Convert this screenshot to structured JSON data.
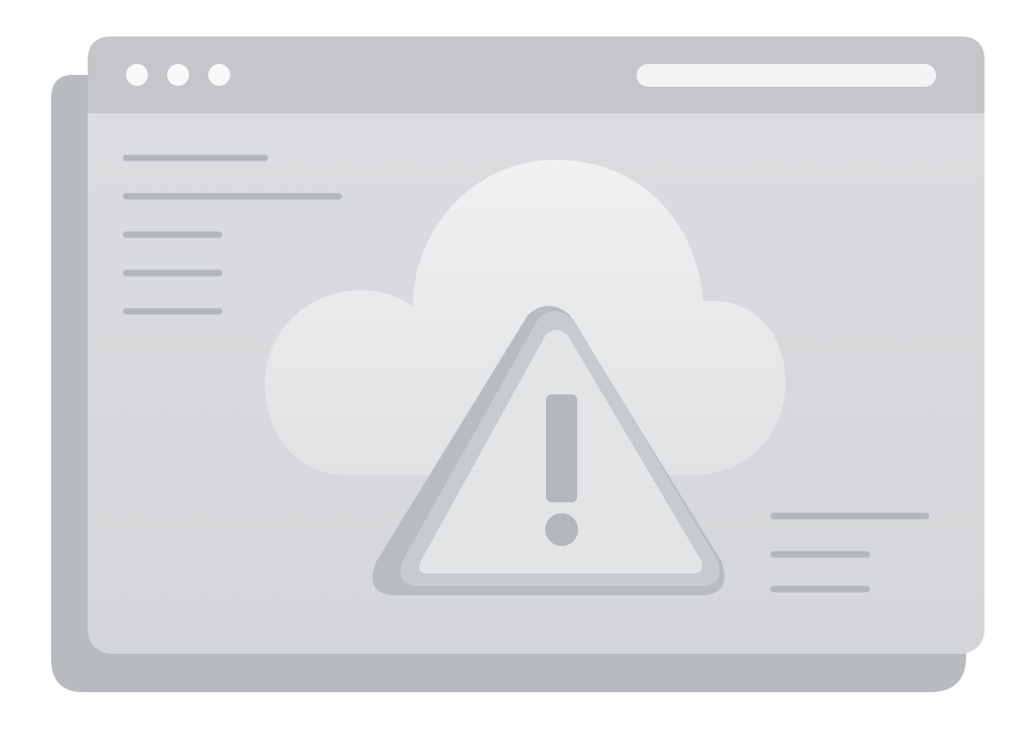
{
  "illustration": {
    "kind": "browser-window-cloud-error",
    "icons": [
      "window-dots-icon",
      "address-bar-icon",
      "cloud-icon",
      "warning-triangle-icon"
    ],
    "colors": {
      "window_back": "#b9bcc0",
      "window_front": "#d9dadd",
      "title_bar": "#c6c8cc",
      "title_dots": "#f7f7f8",
      "address_bar": "#f4f5f6",
      "placeholder_lines": "#b4b7bb",
      "cloud": "#e9eaec",
      "warning_triangle": "#c3c6ca",
      "warning_triangle_inner": "#e5e6e8"
    },
    "texts": []
  }
}
